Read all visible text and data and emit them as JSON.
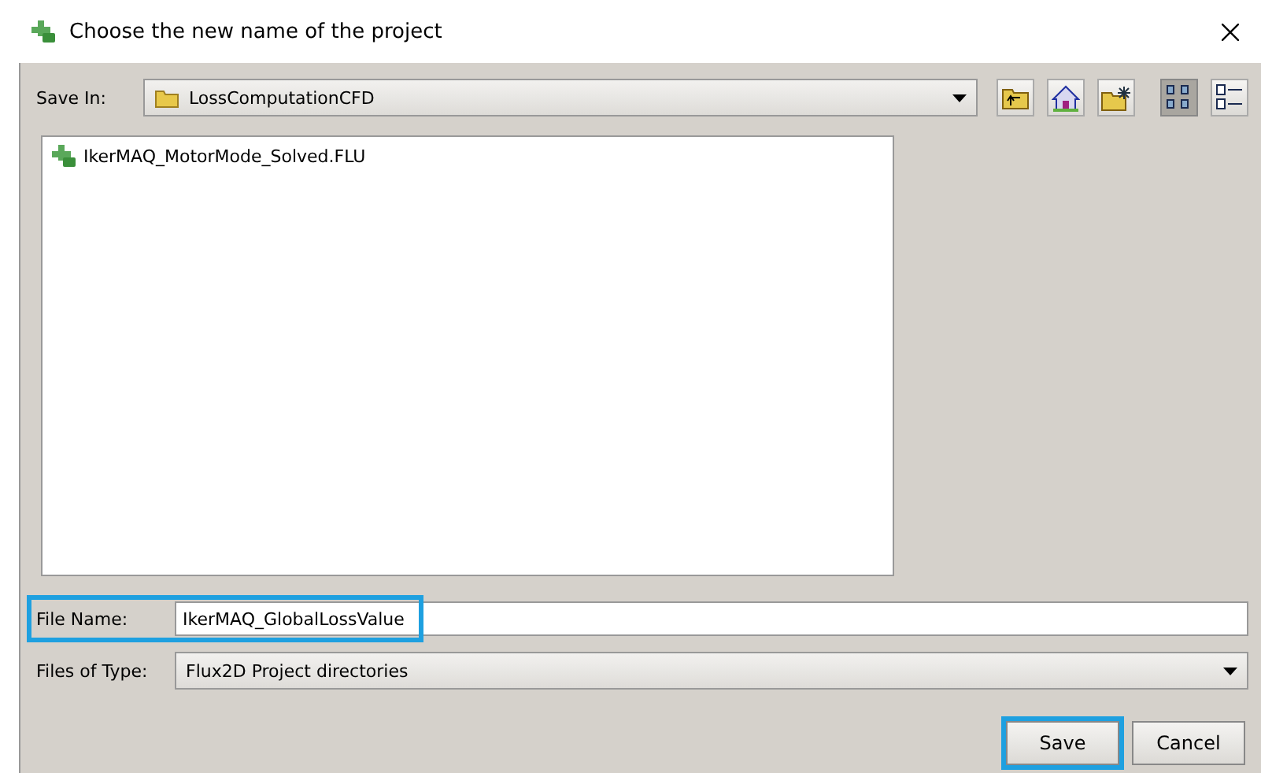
{
  "window": {
    "title": "Choose the new name of the project"
  },
  "save_in": {
    "label": "Save In:",
    "value": "LossComputationCFD"
  },
  "toolbar": [
    {
      "kind": "up"
    },
    {
      "kind": "home"
    },
    {
      "kind": "newfolder"
    },
    {
      "kind": "grid",
      "selected": true
    },
    {
      "kind": "details",
      "selected": false
    }
  ],
  "files": [
    {
      "name": "IkerMAQ_MotorMode_Solved.FLU"
    }
  ],
  "file_name": {
    "label": "File Name:",
    "value": "IkerMAQ_GlobalLossValue",
    "highlighted": true
  },
  "file_type": {
    "label": "Files of Type:",
    "value": "Flux2D Project directories"
  },
  "buttons": [
    {
      "label": "Save",
      "highlighted": true
    },
    {
      "label": "Cancel",
      "highlighted": false
    }
  ]
}
